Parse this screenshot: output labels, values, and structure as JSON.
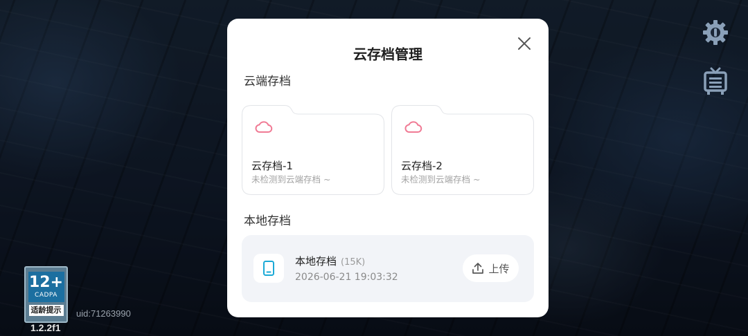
{
  "modal": {
    "title": "云存档管理",
    "cloud_section": {
      "title": "云端存档",
      "slots": [
        {
          "name": "云存档-1",
          "status": "未检测到云端存档 ~"
        },
        {
          "name": "云存档-2",
          "status": "未检测到云端存档 ~"
        }
      ]
    },
    "local_section": {
      "title": "本地存档",
      "save": {
        "name": "本地存档",
        "size": "(15K)",
        "time": "2026-06-21 19:03:32",
        "upload_label": "上传"
      }
    }
  },
  "overlay": {
    "age_rating": "12+",
    "age_org": "CADPA",
    "age_tip": "适龄提示",
    "version": "1.2.2f1",
    "uid": "uid:71263990"
  },
  "icons": {
    "close": "close-icon",
    "cloud": "cloud-icon",
    "device": "phone-icon",
    "upload": "upload-icon",
    "settings": "gear-icon",
    "notice": "notice-board-icon"
  },
  "colors": {
    "cloud_icon": "#f07a94",
    "device_icon": "#1aa9d6",
    "local_card_bg": "#f2f4f8"
  }
}
